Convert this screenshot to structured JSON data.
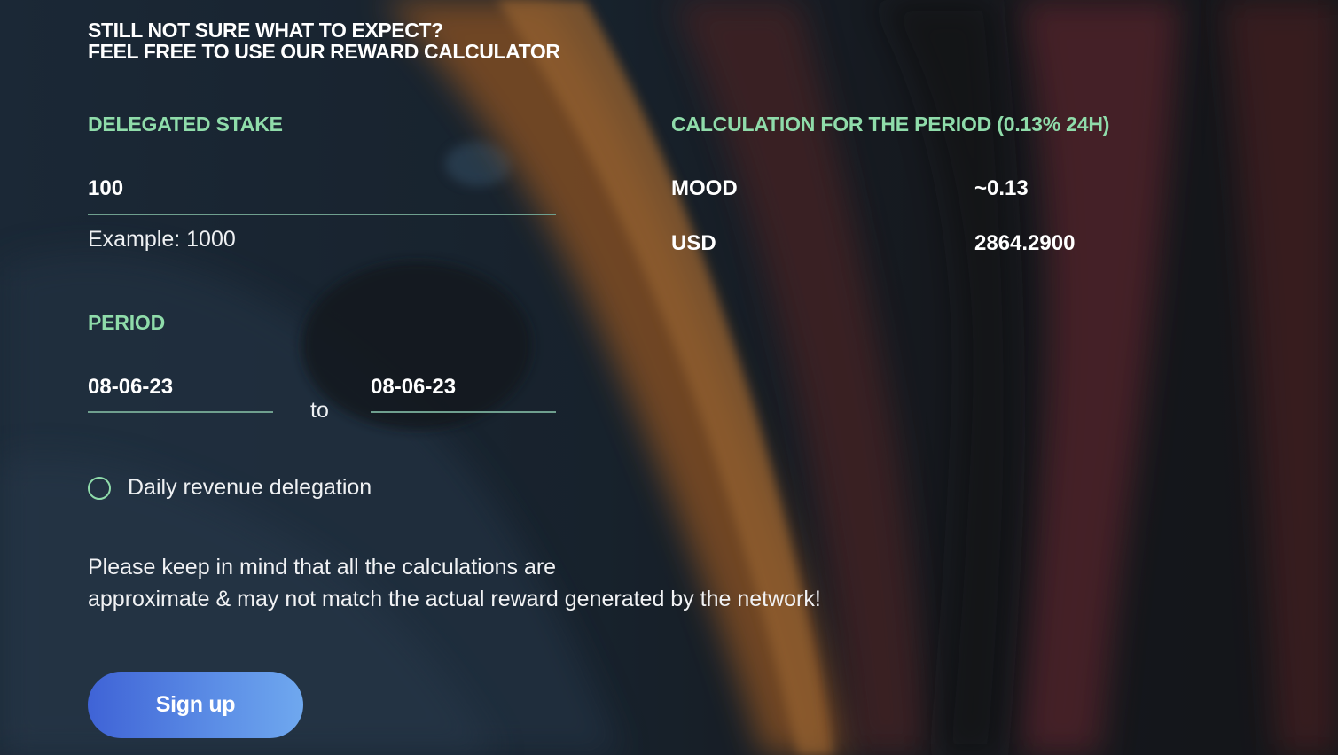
{
  "headline": {
    "line1": "STILL NOT SURE WHAT TO EXPECT?",
    "line2": "FEEL FREE TO USE OUR REWARD CALCULATOR"
  },
  "stake": {
    "label": "DELEGATED STAKE",
    "value": "100",
    "hint": "Example: 1000"
  },
  "period": {
    "label": "PERIOD",
    "from": "08-06-23",
    "to_word": "to",
    "to": "08-06-23"
  },
  "daily_delegation": {
    "label": "Daily revenue delegation",
    "checked": false
  },
  "disclaimer": {
    "line1": "Please keep in mind that all the calculations are",
    "line2": "approximate & may not match the actual reward generated by the network!"
  },
  "signup": {
    "label": "Sign up"
  },
  "calculation": {
    "label": "CALCULATION FOR THE PERIOD (0.13% 24H)",
    "rows": [
      {
        "currency": "MOOD",
        "value": "~0.13"
      },
      {
        "currency": "USD",
        "value": "2864.2900"
      }
    ]
  },
  "colors": {
    "accent_green": "#8fdcaa",
    "underline": "#6f9f8e",
    "button_start": "#3f63d6",
    "button_end": "#6fa8ef"
  }
}
